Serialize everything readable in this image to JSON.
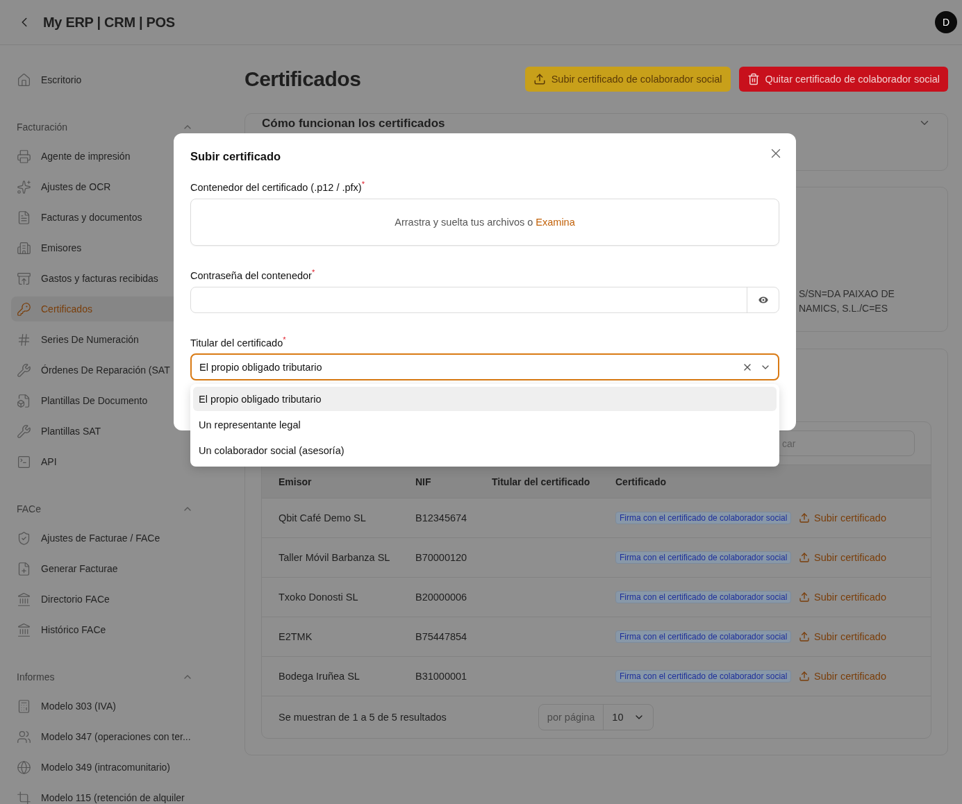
{
  "header": {
    "title": "My ERP | CRM | POS",
    "avatar": "D"
  },
  "sidebar": {
    "top_items": [
      {
        "label": "Escritorio",
        "selected": false
      }
    ],
    "sections": [
      {
        "title": "Facturación",
        "expanded": true,
        "items": [
          {
            "label": "Agente de impresión",
            "selected": false
          },
          {
            "label": "Ajustes de OCR",
            "selected": false
          },
          {
            "label": "Facturas y documentos",
            "selected": false
          },
          {
            "label": "Emisores",
            "selected": false
          },
          {
            "label": "Gastos y facturas recibidas",
            "selected": false
          },
          {
            "label": "Certificados",
            "selected": true
          },
          {
            "label": "Series De Numeración",
            "selected": false
          },
          {
            "label": "Órdenes De Reparación (SAT",
            "selected": false
          },
          {
            "label": "Plantillas De Documento",
            "selected": false
          },
          {
            "label": "Plantillas SAT",
            "selected": false
          },
          {
            "label": "API",
            "selected": false
          }
        ]
      },
      {
        "title": "FACe",
        "expanded": true,
        "items": [
          {
            "label": "Ajustes de Facturae / FACe",
            "selected": false
          },
          {
            "label": "Generar Facturae",
            "selected": false
          },
          {
            "label": "Directorio FACe",
            "selected": false
          },
          {
            "label": "Histórico FACe",
            "selected": false
          }
        ]
      },
      {
        "title": "Informes",
        "expanded": true,
        "items": [
          {
            "label": "Modelo 303 (IVA)",
            "selected": false
          },
          {
            "label": "Modelo 347 (operaciones con ter...",
            "selected": false
          },
          {
            "label": "Modelo 349 (intracomunitario)",
            "selected": false
          },
          {
            "label": "Modelo 115 (retención de alquiler",
            "selected": false
          }
        ]
      }
    ]
  },
  "page": {
    "title": "Certificados",
    "buttons": [
      {
        "label": "Subir certificado de colaborador social",
        "kind": "warning"
      },
      {
        "label": "Quitar certificado de colaborador social",
        "kind": "danger"
      }
    ]
  },
  "accordion": {
    "title": "Cómo funcionan los certificados",
    "expanded": false
  },
  "info_card": {
    "lines": [
      "S/SN=DA PAIXAO DE",
      "NAMICS, S.L./C=ES"
    ]
  },
  "table": {
    "search_placeholder": "car",
    "columns": [
      "Emisor",
      "NIF",
      "Titular del certificado",
      "Certificado"
    ],
    "rows": [
      {
        "emisor": "Qbit Café Demo SL",
        "nif": "B12345674",
        "badge": "Firma con el certificado de colaborador social",
        "action": "Subir certificado"
      },
      {
        "emisor": "Taller Móvil Barbanza SL",
        "nif": "B70000120",
        "badge": "Firma con el certificado de colaborador social",
        "action": "Subir certificado"
      },
      {
        "emisor": "Txoko Donosti SL",
        "nif": "B20000006",
        "badge": "Firma con el certificado de colaborador social",
        "action": "Subir certificado"
      },
      {
        "emisor": "E2TMK",
        "nif": "B75447854",
        "badge": "Firma con el certificado de colaborador social",
        "action": "Subir certificado"
      },
      {
        "emisor": "Bodega Iruñea SL",
        "nif": "B31000001",
        "badge": "Firma con el certificado de colaborador social",
        "action": "Subir certificado"
      }
    ],
    "footer": {
      "summary": "Se muestran de 1 a 5 de 5 resultados",
      "per_page_label": "por página",
      "per_page_value": "10"
    }
  },
  "modal": {
    "title": "Subir certificado",
    "file_field": {
      "label": "Contenedor del certificado (.p12 / .pfx)",
      "required_mark": "*",
      "hint": "Arrastra y suelta tus archivos o",
      "link": "Examina"
    },
    "password_field": {
      "label": "Contraseña del contenedor",
      "required_mark": "*"
    },
    "holder_field": {
      "label": "Titular del certificado",
      "required_mark": "*",
      "value": "El propio obligado tributario",
      "expanded": true,
      "options": [
        {
          "label": "El propio obligado tributario",
          "selected": true
        },
        {
          "label": "Un representante legal",
          "selected": false
        },
        {
          "label": "Un colaborador social (asesoría)",
          "selected": false
        }
      ]
    }
  }
}
